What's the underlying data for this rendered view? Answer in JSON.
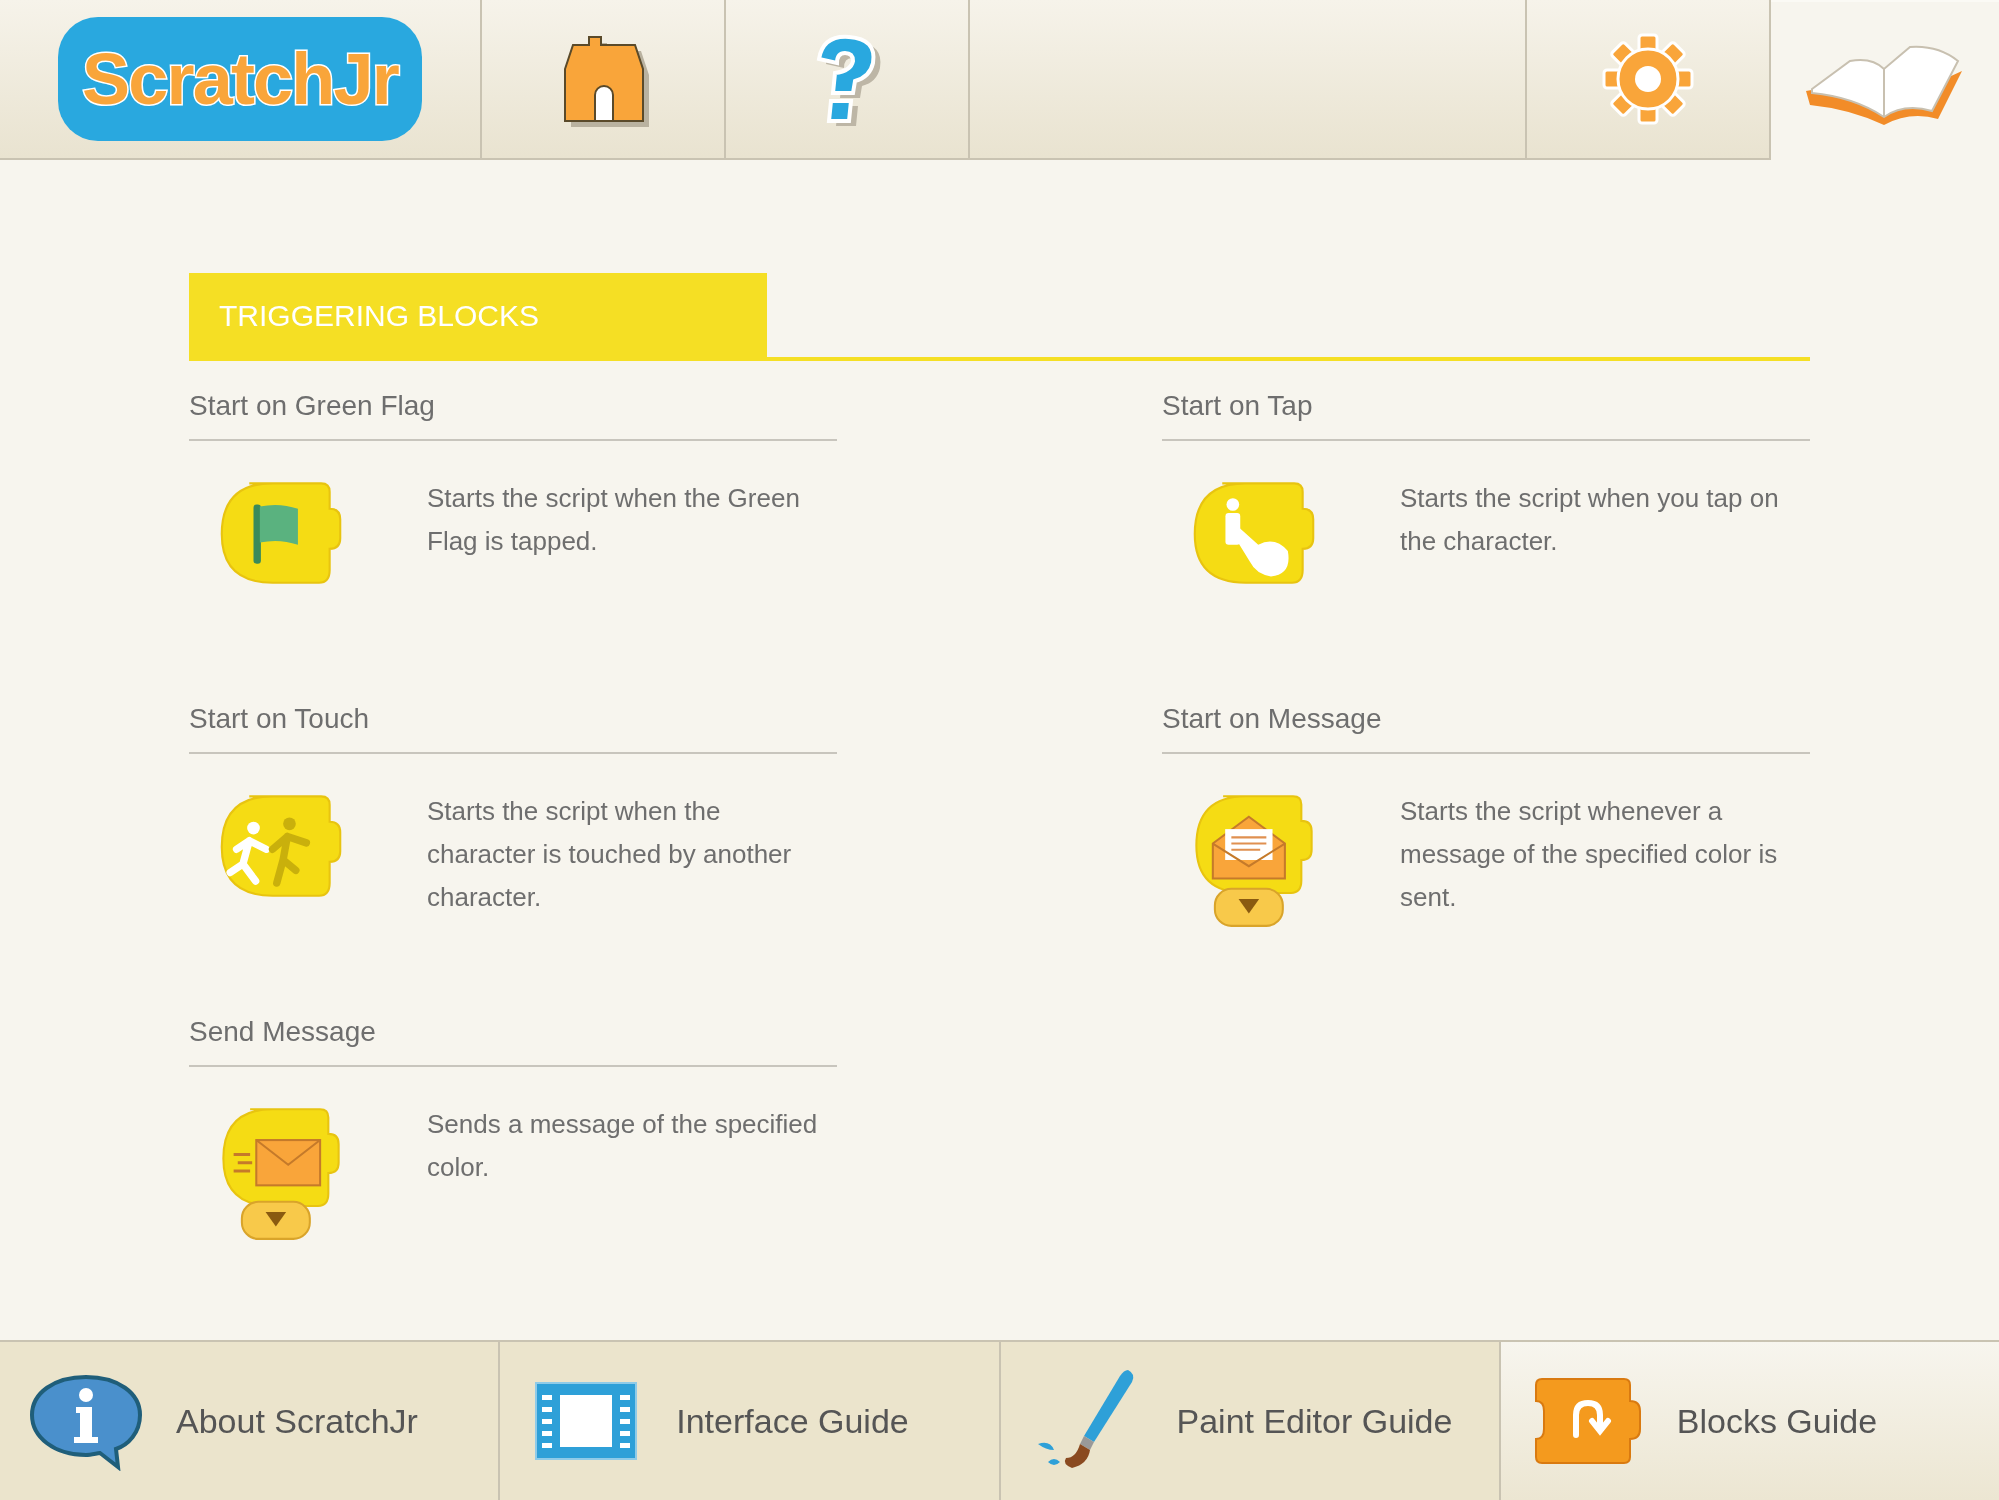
{
  "top_bar": {
    "logo": "ScratchJr",
    "items": [
      {
        "kind": "home",
        "selected": false
      },
      {
        "kind": "help",
        "selected": false
      },
      {
        "kind": "spacer"
      },
      {
        "kind": "settings",
        "selected": false
      },
      {
        "kind": "book",
        "selected": true
      }
    ]
  },
  "section": {
    "title": "TRIGGERING BLOCKS"
  },
  "blocks": [
    {
      "kind": "green-flag",
      "name": "Start on Green Flag",
      "description": "Starts the script when the Green Flag is tapped."
    },
    {
      "kind": "tap",
      "name": "Start on Tap",
      "description": "Starts the script when you tap on the character."
    },
    {
      "kind": "touch",
      "name": "Start on Touch",
      "description": "Starts the script when the character is touched by another character."
    },
    {
      "kind": "message-in",
      "name": "Start on Message",
      "description": "Starts the script whenever a message of the specified color is sent."
    },
    {
      "kind": "message-out",
      "name": "Send Message",
      "description": "Sends a message of the specified color."
    }
  ],
  "bottom_tabs": [
    {
      "kind": "info",
      "label": "About ScratchJr",
      "selected": false
    },
    {
      "kind": "interface",
      "label": "Interface Guide",
      "selected": false
    },
    {
      "kind": "paint",
      "label": "Paint Editor Guide",
      "selected": false
    },
    {
      "kind": "blocks",
      "label": "Blocks Guide",
      "selected": true
    }
  ]
}
